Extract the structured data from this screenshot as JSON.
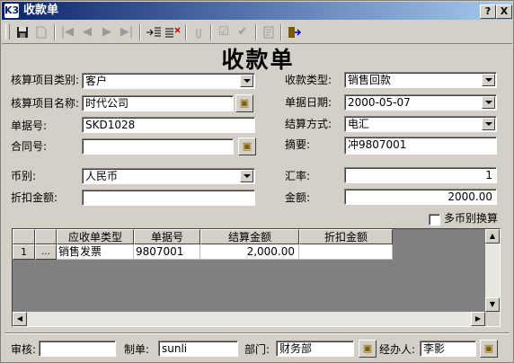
{
  "window": {
    "title": "收款单",
    "logo": "K3",
    "help_btn": "?",
    "close_btn": "X"
  },
  "toolbar": {
    "icons": [
      "save-icon",
      "new-icon",
      "first-icon",
      "prev-icon",
      "next-icon",
      "last-icon",
      "insert-row-icon",
      "delete-row-icon",
      "attach-icon",
      "check-icon",
      "approve-icon",
      "view-icon",
      "exit-icon"
    ]
  },
  "form": {
    "title": "收款单",
    "account_category_label": "核算项目类别:",
    "account_category_value": "客户",
    "account_name_label": "核算项目名称:",
    "account_name_value": "时代公司",
    "doc_no_label": "单据号:",
    "doc_no_value": "SKD1028",
    "contract_no_label": "合同号:",
    "contract_no_value": "",
    "currency_label": "币别:",
    "currency_value": "人民币",
    "discount_label": "折扣金额:",
    "discount_value": "",
    "receipt_type_label": "收款类型:",
    "receipt_type_value": "销售回款",
    "doc_date_label": "单据日期:",
    "doc_date_value": "2000-05-07",
    "settle_method_label": "结算方式:",
    "settle_method_value": "电汇",
    "summary_label": "摘要:",
    "summary_value": "冲9807001",
    "rate_label": "汇率:",
    "rate_value": "1",
    "amount_label": "金额:",
    "amount_value": "2000.00",
    "multi_currency_label": "多币别换算",
    "multi_currency_checked": false
  },
  "grid": {
    "headers": [
      "应收单类型",
      "单据号",
      "结算金额",
      "折扣金额"
    ],
    "rows": [
      {
        "no": "1",
        "btn": "...",
        "type": "销售发票",
        "doc_no": "9807001",
        "settle_amount": "2,000.00",
        "discount": ""
      }
    ]
  },
  "footer": {
    "auditor_label": "审核:",
    "auditor_value": "",
    "maker_label": "制单:",
    "maker_value": "sunli",
    "dept_label": "部门:",
    "dept_value": "财务部",
    "handler_label": "经办人:",
    "handler_value": "李影"
  }
}
